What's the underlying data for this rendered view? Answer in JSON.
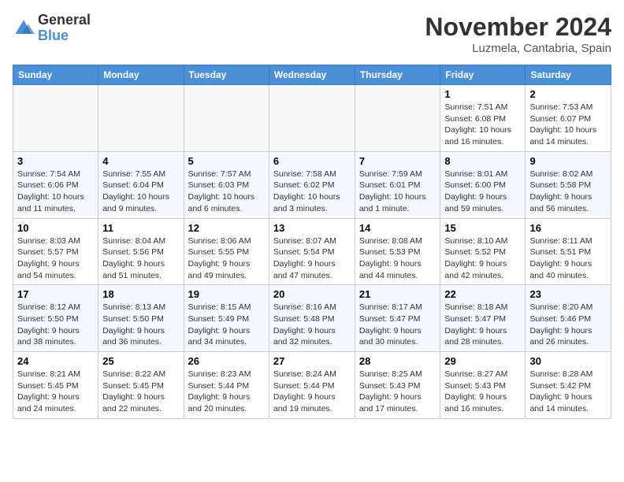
{
  "logo": {
    "general": "General",
    "blue": "Blue"
  },
  "title": "November 2024",
  "location": "Luzmela, Cantabria, Spain",
  "weekdays": [
    "Sunday",
    "Monday",
    "Tuesday",
    "Wednesday",
    "Thursday",
    "Friday",
    "Saturday"
  ],
  "weeks": [
    [
      {
        "day": "",
        "info": ""
      },
      {
        "day": "",
        "info": ""
      },
      {
        "day": "",
        "info": ""
      },
      {
        "day": "",
        "info": ""
      },
      {
        "day": "",
        "info": ""
      },
      {
        "day": "1",
        "info": "Sunrise: 7:51 AM\nSunset: 6:08 PM\nDaylight: 10 hours and 16 minutes."
      },
      {
        "day": "2",
        "info": "Sunrise: 7:53 AM\nSunset: 6:07 PM\nDaylight: 10 hours and 14 minutes."
      }
    ],
    [
      {
        "day": "3",
        "info": "Sunrise: 7:54 AM\nSunset: 6:06 PM\nDaylight: 10 hours and 11 minutes."
      },
      {
        "day": "4",
        "info": "Sunrise: 7:55 AM\nSunset: 6:04 PM\nDaylight: 10 hours and 9 minutes."
      },
      {
        "day": "5",
        "info": "Sunrise: 7:57 AM\nSunset: 6:03 PM\nDaylight: 10 hours and 6 minutes."
      },
      {
        "day": "6",
        "info": "Sunrise: 7:58 AM\nSunset: 6:02 PM\nDaylight: 10 hours and 3 minutes."
      },
      {
        "day": "7",
        "info": "Sunrise: 7:59 AM\nSunset: 6:01 PM\nDaylight: 10 hours and 1 minute."
      },
      {
        "day": "8",
        "info": "Sunrise: 8:01 AM\nSunset: 6:00 PM\nDaylight: 9 hours and 59 minutes."
      },
      {
        "day": "9",
        "info": "Sunrise: 8:02 AM\nSunset: 5:58 PM\nDaylight: 9 hours and 56 minutes."
      }
    ],
    [
      {
        "day": "10",
        "info": "Sunrise: 8:03 AM\nSunset: 5:57 PM\nDaylight: 9 hours and 54 minutes."
      },
      {
        "day": "11",
        "info": "Sunrise: 8:04 AM\nSunset: 5:56 PM\nDaylight: 9 hours and 51 minutes."
      },
      {
        "day": "12",
        "info": "Sunrise: 8:06 AM\nSunset: 5:55 PM\nDaylight: 9 hours and 49 minutes."
      },
      {
        "day": "13",
        "info": "Sunrise: 8:07 AM\nSunset: 5:54 PM\nDaylight: 9 hours and 47 minutes."
      },
      {
        "day": "14",
        "info": "Sunrise: 8:08 AM\nSunset: 5:53 PM\nDaylight: 9 hours and 44 minutes."
      },
      {
        "day": "15",
        "info": "Sunrise: 8:10 AM\nSunset: 5:52 PM\nDaylight: 9 hours and 42 minutes."
      },
      {
        "day": "16",
        "info": "Sunrise: 8:11 AM\nSunset: 5:51 PM\nDaylight: 9 hours and 40 minutes."
      }
    ],
    [
      {
        "day": "17",
        "info": "Sunrise: 8:12 AM\nSunset: 5:50 PM\nDaylight: 9 hours and 38 minutes."
      },
      {
        "day": "18",
        "info": "Sunrise: 8:13 AM\nSunset: 5:50 PM\nDaylight: 9 hours and 36 minutes."
      },
      {
        "day": "19",
        "info": "Sunrise: 8:15 AM\nSunset: 5:49 PM\nDaylight: 9 hours and 34 minutes."
      },
      {
        "day": "20",
        "info": "Sunrise: 8:16 AM\nSunset: 5:48 PM\nDaylight: 9 hours and 32 minutes."
      },
      {
        "day": "21",
        "info": "Sunrise: 8:17 AM\nSunset: 5:47 PM\nDaylight: 9 hours and 30 minutes."
      },
      {
        "day": "22",
        "info": "Sunrise: 8:18 AM\nSunset: 5:47 PM\nDaylight: 9 hours and 28 minutes."
      },
      {
        "day": "23",
        "info": "Sunrise: 8:20 AM\nSunset: 5:46 PM\nDaylight: 9 hours and 26 minutes."
      }
    ],
    [
      {
        "day": "24",
        "info": "Sunrise: 8:21 AM\nSunset: 5:45 PM\nDaylight: 9 hours and 24 minutes."
      },
      {
        "day": "25",
        "info": "Sunrise: 8:22 AM\nSunset: 5:45 PM\nDaylight: 9 hours and 22 minutes."
      },
      {
        "day": "26",
        "info": "Sunrise: 8:23 AM\nSunset: 5:44 PM\nDaylight: 9 hours and 20 minutes."
      },
      {
        "day": "27",
        "info": "Sunrise: 8:24 AM\nSunset: 5:44 PM\nDaylight: 9 hours and 19 minutes."
      },
      {
        "day": "28",
        "info": "Sunrise: 8:25 AM\nSunset: 5:43 PM\nDaylight: 9 hours and 17 minutes."
      },
      {
        "day": "29",
        "info": "Sunrise: 8:27 AM\nSunset: 5:43 PM\nDaylight: 9 hours and 16 minutes."
      },
      {
        "day": "30",
        "info": "Sunrise: 8:28 AM\nSunset: 5:42 PM\nDaylight: 9 hours and 14 minutes."
      }
    ]
  ]
}
